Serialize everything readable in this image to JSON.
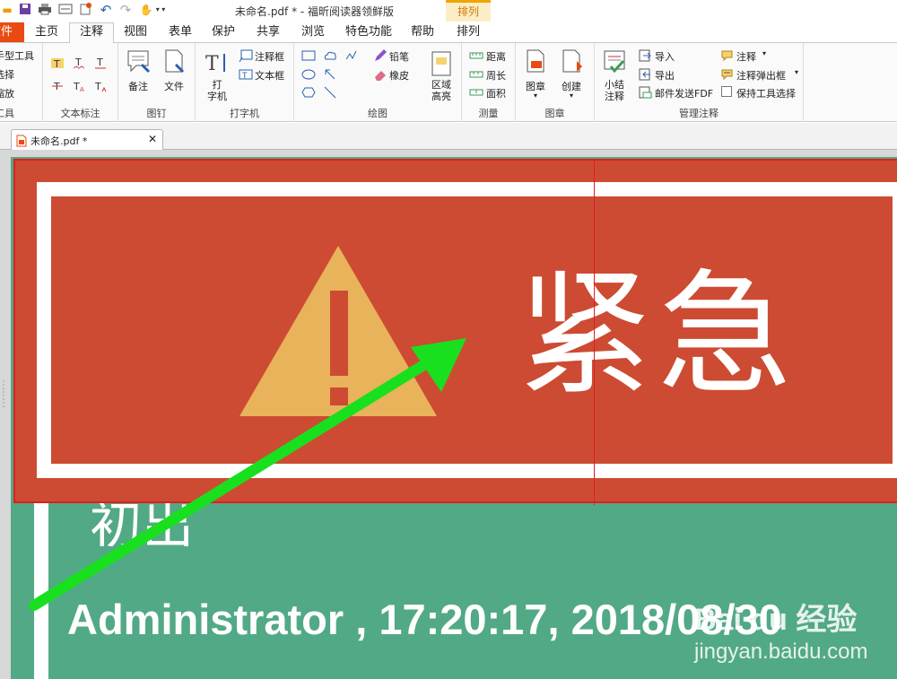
{
  "app": {
    "title": "未命名.pdf * - 福昕阅读器领鲜版",
    "context_tab_group": "排列",
    "quick_access_icons": [
      "open-folder-icon",
      "save-icon",
      "print-icon",
      "scan-icon",
      "new-doc-icon",
      "undo-icon",
      "redo-icon",
      "hand-tool-icon",
      "customize-icon"
    ]
  },
  "tabs": {
    "file": "文件",
    "items": [
      "主页",
      "注释",
      "视图",
      "表单",
      "保护",
      "共享",
      "浏览",
      "特色功能",
      "帮助",
      "排列"
    ],
    "active": "注释"
  },
  "ribbon": {
    "tools_group": {
      "items": [
        "手型工具",
        "选择",
        "缩放"
      ],
      "label": "工具"
    },
    "text_markup": {
      "label": "文本标注"
    },
    "pin": {
      "note": "备注",
      "file": "文件",
      "label": "图钉"
    },
    "typewriter": {
      "typewriter": "打\n字机",
      "callout": "注释框",
      "textbox": "文本框",
      "label": "打字机"
    },
    "drawing": {
      "pencil": "铅笔",
      "eraser": "橡皮",
      "area_highlight": "区域\n高亮",
      "label": "绘图"
    },
    "measure": {
      "distance": "距离",
      "perimeter": "周长",
      "area": "面积",
      "label": "测量"
    },
    "stamp": {
      "stamp": "图章",
      "create": "创建",
      "label": "图章"
    },
    "manage": {
      "summary": "小结\n注释",
      "import": "导入",
      "export": "导出",
      "email_fdf": "邮件发送FDF",
      "annotations": "注释",
      "popup": "注释弹出框",
      "keep_tool": "保持工具选择",
      "label": "管理注释"
    }
  },
  "document_tab": {
    "name": "未命名.pdf *",
    "close": "✕"
  },
  "page": {
    "stamp_text": "紧急",
    "partial_text": "初出",
    "author_line": "Administrator , 17:20:17, 2018/08/30",
    "watermark_brand": "Bai du 经验",
    "watermark_url": "jingyan.baidu.com"
  },
  "colors": {
    "accent": "#e84a12",
    "stamp_red": "#cd4b33",
    "page_green": "#52a985",
    "triangle": "#e8b35a",
    "arrow": "#19e01e"
  }
}
